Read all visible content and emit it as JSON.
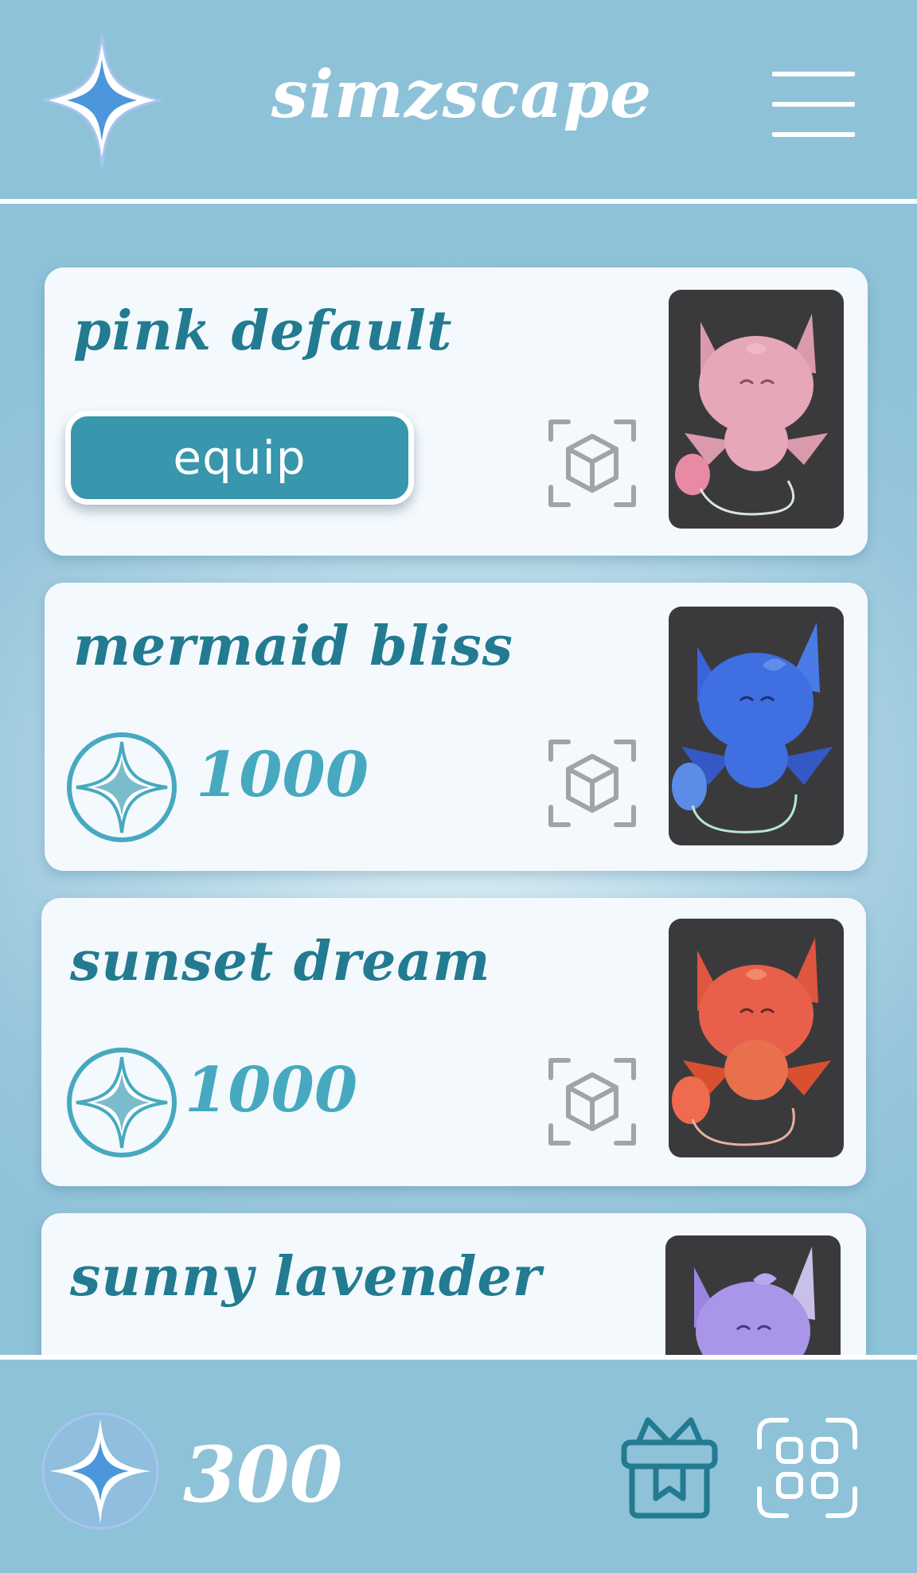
{
  "header": {
    "title": "simzscape",
    "logo_icon": "sparkle-star-icon",
    "menu_icon": "hamburger-menu-icon"
  },
  "skins": [
    {
      "name": "pink default",
      "action_label": "equip",
      "price": null,
      "color": "#e6a7b8"
    },
    {
      "name": "mermaid bliss",
      "action_label": null,
      "price": "1000",
      "color": "#3f6fe0"
    },
    {
      "name": "sunset dream",
      "action_label": null,
      "price": "1000",
      "color": "#e8604c"
    },
    {
      "name": "sunny lavender",
      "action_label": null,
      "price": null,
      "color": "#a996e8"
    }
  ],
  "footer": {
    "balance": "300",
    "gift_icon": "gift-box-icon",
    "scan_icon": "scan-icon"
  },
  "colors": {
    "bar": "#8ec2d8",
    "title_text": "#227b90",
    "button": "#3896ad",
    "price": "#46a9bf"
  }
}
